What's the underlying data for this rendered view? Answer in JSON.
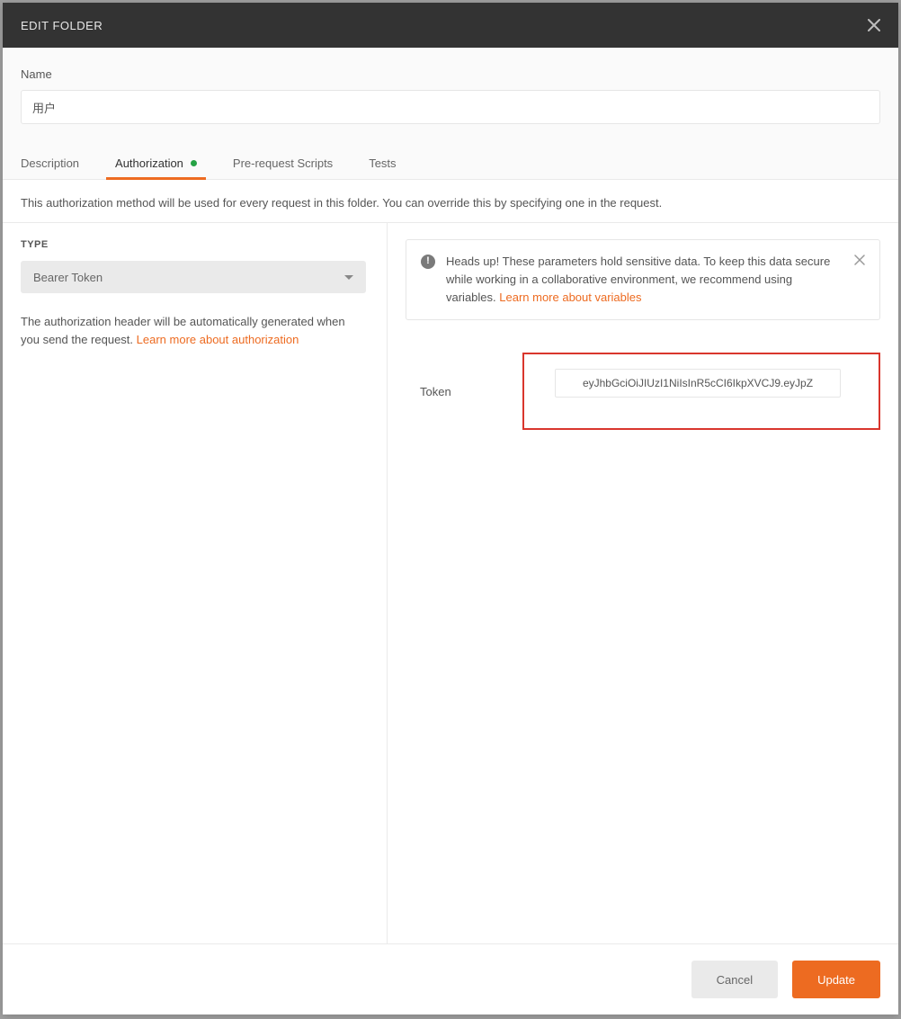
{
  "modal": {
    "title": "EDIT FOLDER"
  },
  "name": {
    "label": "Name",
    "value": "用户"
  },
  "tabs": {
    "description": "Description",
    "authorization": "Authorization",
    "prerequest": "Pre-request Scripts",
    "tests": "Tests"
  },
  "auth": {
    "info": "This authorization method will be used for every request in this folder. You can override this by specifying one in the request.",
    "type_label": "TYPE",
    "type_value": "Bearer Token",
    "header_note_1": "The authorization header will be automatically generated when you send the request. ",
    "header_note_link": "Learn more about authorization",
    "alert_text": "Heads up! These parameters hold sensitive data. To keep this data secure while working in a collaborative environment, we recommend using variables. ",
    "alert_link": "Learn more about variables",
    "token_label": "Token",
    "token_value": "eyJhbGciOiJIUzI1NiIsInR5cCI6IkpXVCJ9.eyJpZ"
  },
  "footer": {
    "cancel": "Cancel",
    "update": "Update"
  }
}
